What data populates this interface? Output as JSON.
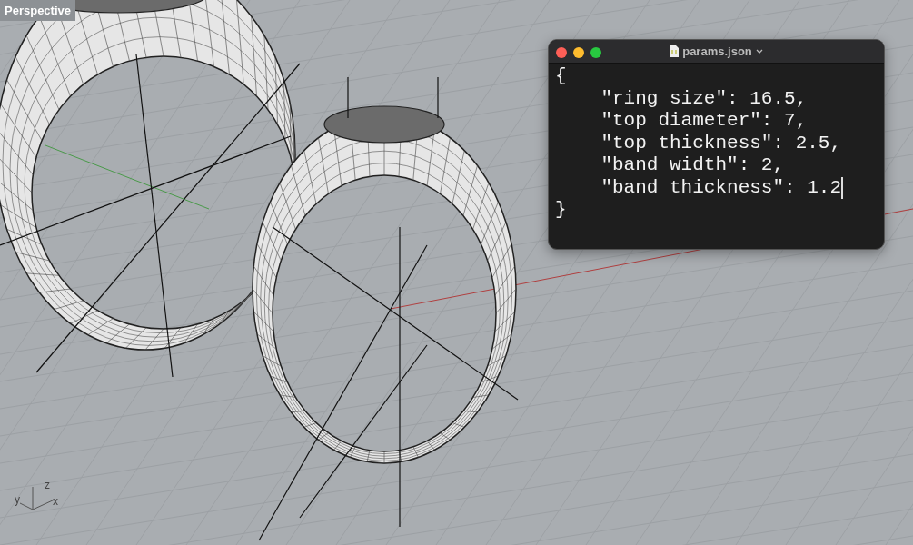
{
  "viewport": {
    "title": "Perspective",
    "axes": {
      "x": "x",
      "y": "y",
      "z": "z"
    }
  },
  "editor": {
    "title": "params.json",
    "lines": [
      {
        "text": "{",
        "cursor": false
      },
      {
        "text": "    \"ring size\": 16.5,",
        "cursor": false
      },
      {
        "text": "    \"top diameter\": 7,",
        "cursor": false
      },
      {
        "text": "    \"top thickness\": 2.5,",
        "cursor": false
      },
      {
        "text": "    \"band width\": 2,",
        "cursor": false
      },
      {
        "text": "    \"band thickness\": 1.2",
        "cursor": true
      },
      {
        "text": "}",
        "cursor": false
      }
    ]
  }
}
